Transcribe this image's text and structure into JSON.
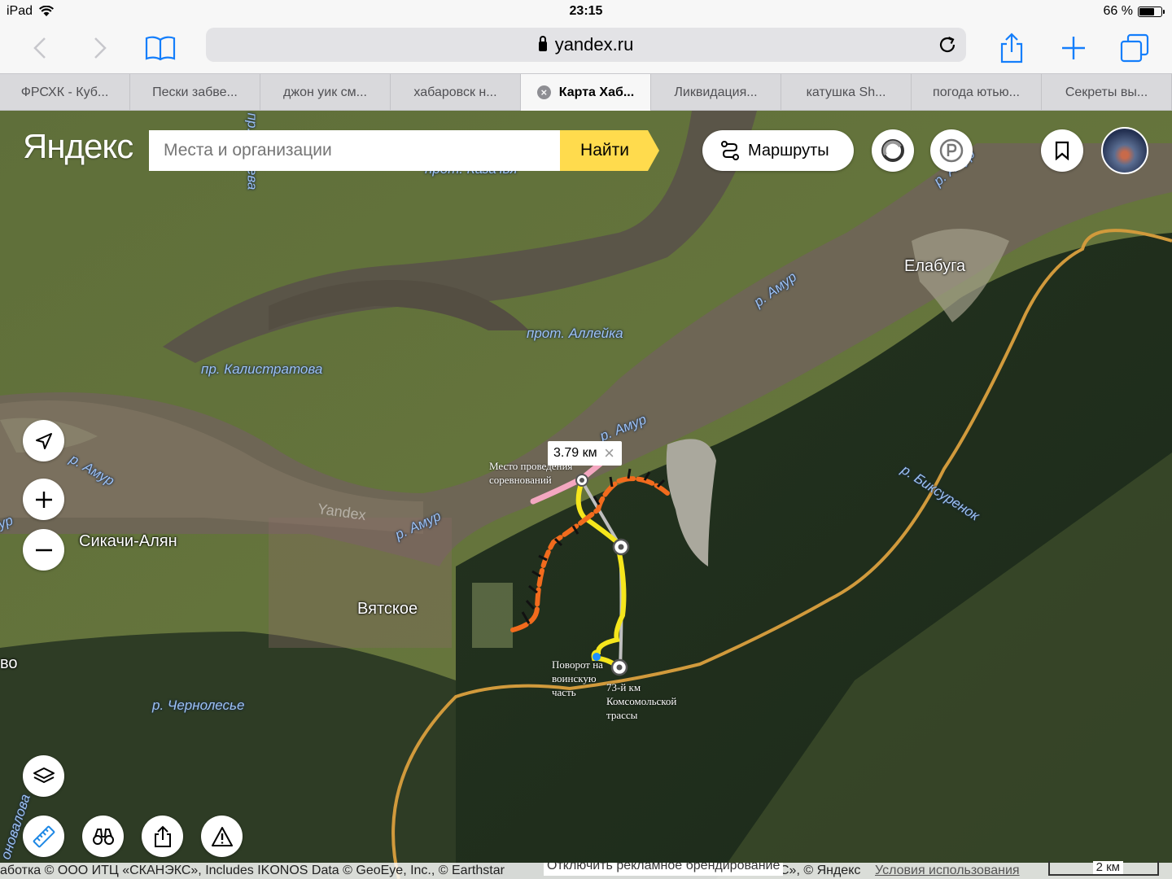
{
  "status_bar": {
    "device": "iPad",
    "time": "23:15",
    "battery": "66 %",
    "battery_level": 0.66
  },
  "browser": {
    "url": "yandex.ru",
    "tabs": [
      {
        "label": "ФРСХК - Куб..."
      },
      {
        "label": "Пески забве..."
      },
      {
        "label": "джон уик см..."
      },
      {
        "label": "хабаровск н..."
      },
      {
        "label": "Карта Хаб...",
        "active": true
      },
      {
        "label": "Ликвидация..."
      },
      {
        "label": "катушка Sh..."
      },
      {
        "label": "погода ютью..."
      },
      {
        "label": "Секреты вы..."
      }
    ]
  },
  "map": {
    "logo": "Яндекс",
    "search_placeholder": "Места и организации",
    "search_button": "Найти",
    "routes_button": "Маршруты",
    "watermark": "Yandex",
    "distance": "3.79 км",
    "places": {
      "elabuga": "Елабуга",
      "sikachi": "Сикачи-Алян",
      "vyatskoe": "Вятское",
      "edge": "во"
    },
    "rivers": {
      "amur_top_right": "р. Амур",
      "amur_mid": "р. Амур",
      "amur_near_route": "р. Амур",
      "amur_left": "р. Амур",
      "amur_bottom": "р. Амур",
      "amur_edge": "ур",
      "alleyka": "прот. Аллейка",
      "kalistratova": "пр. Калистратова",
      "kazachya": "прот. Казачья",
      "nechaeva": "пр. Нечаева",
      "bikcurenok": "р. Бикcуренок",
      "chernolesye": "р. Чернолесье",
      "kovalova": "оновалова"
    },
    "notes": {
      "competition": "Место проведения соревнований",
      "turn": "Поворот на воинскую часть",
      "km73": "73-й км Комсомольской трассы"
    },
    "copyright": "аботка © ООО ИТЦ «СКАНЭКС», Includes IKONOS Data © GeoEye, Inc., © Earthstar",
    "copyright_tail": "С», © Яндекс",
    "ads_link": "Отключить рекламное брендирование",
    "terms_link": "Условия использования",
    "scale": "2 км"
  },
  "colors": {
    "search_button": "#ffdb4d",
    "route_yellow": "#f5e61c",
    "route_pink": "#f4a7c0",
    "route_orange": "#f26b1d",
    "road": "#d19a3c",
    "river_label": "#9cc1f5"
  },
  "icons": {
    "back": "chevron-left-icon",
    "forward": "chevron-right-icon",
    "bookmarks": "open-book-icon",
    "share": "share-icon",
    "new_tab": "plus-icon",
    "tabs": "tabs-icon",
    "routes": "route-icon",
    "traffic": "traffic-icon",
    "parking": "parking-icon",
    "bookmark": "bookmark-icon",
    "locate": "location-arrow-icon",
    "zoom_in": "plus-icon",
    "zoom_out": "minus-icon",
    "layers": "layers-icon",
    "ruler": "ruler-icon",
    "panorama": "binoculars-icon",
    "share_map": "share-icon",
    "report": "warning-icon"
  }
}
